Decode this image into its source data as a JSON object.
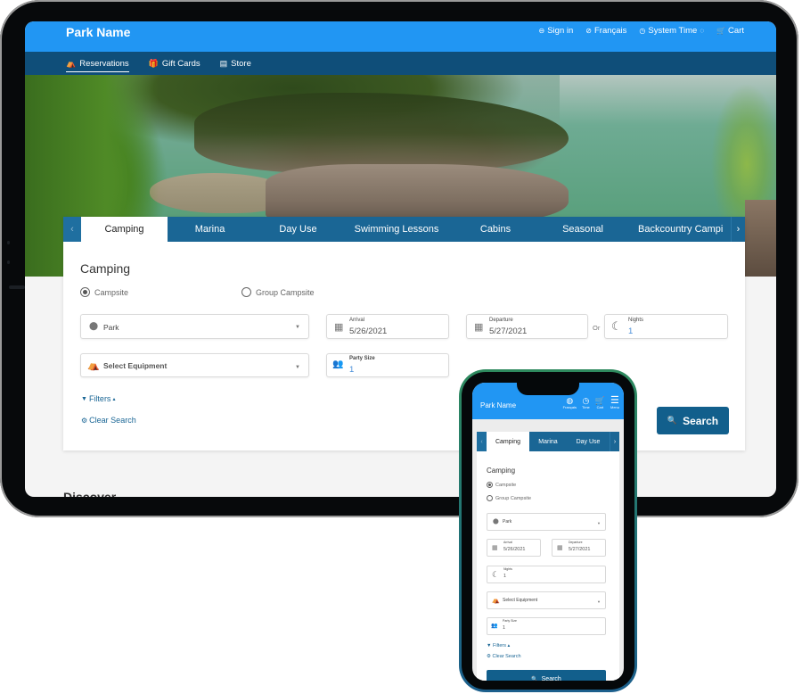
{
  "tablet": {
    "header": {
      "brand": "Park Name",
      "utility_links": [
        {
          "icon": "user-icon",
          "glyph": "⊖",
          "label": "Sign in"
        },
        {
          "icon": "globe-icon",
          "glyph": "⊘",
          "label": "Français"
        },
        {
          "icon": "clock-icon",
          "glyph": "◷",
          "label": "System Time"
        },
        {
          "icon": "cart-icon",
          "glyph": "🛒",
          "label": "Cart"
        }
      ],
      "system_time_suffix_glyph": "◌"
    },
    "subnav": [
      {
        "icon": "tent-icon",
        "glyph": "⛺",
        "label": "Reservations",
        "active": true
      },
      {
        "icon": "gift-icon",
        "glyph": "🎁",
        "label": "Gift Cards",
        "active": false
      },
      {
        "icon": "store-icon",
        "glyph": "▤",
        "label": "Store",
        "active": false
      }
    ],
    "tabs": {
      "prev_glyph": "‹",
      "next_glyph": "›",
      "items": [
        "Camping",
        "Marina",
        "Day Use",
        "Swimming Lessons",
        "Cabins",
        "Seasonal",
        "Backcountry Campi"
      ],
      "active": "Camping"
    },
    "form": {
      "title": "Camping",
      "radios": [
        {
          "label": "Campsite",
          "checked": true
        },
        {
          "label": "Group Campsite",
          "checked": false
        }
      ],
      "park": {
        "icon_glyph": "⬤",
        "value": "Park",
        "caret": "▼"
      },
      "arrival": {
        "label": "Arrival",
        "value": "5/26/2021",
        "icon_glyph": "▦"
      },
      "or_label": "Or",
      "departure": {
        "label": "Departure",
        "value": "5/27/2021",
        "icon_glyph": "▦"
      },
      "nights": {
        "label": "Nights",
        "value": "1",
        "icon_glyph": "☾"
      },
      "equipment": {
        "icon_glyph": "⛺",
        "placeholder": "Select Equipment",
        "caret": "▼"
      },
      "party_size": {
        "label": "Party Size",
        "value": "1",
        "icon_glyph": "👥"
      },
      "filters": {
        "label": "Filters",
        "icon_glyph": "▼",
        "toggle_glyph": "▴"
      },
      "clear_search": {
        "label": "Clear Search",
        "icon_glyph": "⚙"
      },
      "search_button": {
        "label": "Search",
        "icon_glyph": "🔍"
      }
    },
    "discover_heading": "Discover"
  },
  "phone": {
    "header": {
      "brand": "Park Name",
      "icons": [
        {
          "icon": "globe-icon",
          "glyph": "◍",
          "label": "Français"
        },
        {
          "icon": "clock-icon",
          "glyph": "◷",
          "label": "Time"
        },
        {
          "icon": "cart-icon",
          "glyph": "🛒",
          "label": "Cart"
        },
        {
          "icon": "menu-icon",
          "glyph": "☰",
          "label": "Menu"
        }
      ]
    },
    "tabs": {
      "prev_glyph": "‹",
      "next_glyph": "›",
      "items": [
        "Camping",
        "Marina",
        "Day Use"
      ],
      "active": "Camping"
    },
    "form": {
      "title": "Camping",
      "radios": [
        {
          "label": "Campsite",
          "checked": true
        },
        {
          "label": "Group Campsite",
          "checked": false
        }
      ],
      "park": {
        "value": "Park",
        "icon_glyph": "⬤",
        "caret": "▼"
      },
      "arrival": {
        "label": "Arrival",
        "value": "5/26/2021",
        "icon_glyph": "▦"
      },
      "departure": {
        "label": "Departure",
        "value": "5/27/2021",
        "icon_glyph": "▦"
      },
      "nights": {
        "label": "Nights",
        "value": "1",
        "icon_glyph": "☾"
      },
      "equipment": {
        "placeholder": "Select Equipment",
        "icon_glyph": "⛺",
        "caret": "▼"
      },
      "party_size": {
        "label": "Party Size",
        "value": "1",
        "icon_glyph": "👥"
      },
      "filters": {
        "label": "Filters",
        "icon_glyph": "▼",
        "toggle_glyph": "▴"
      },
      "clear_search": {
        "label": "Clear Search",
        "icon_glyph": "⚙"
      },
      "search_button": {
        "label": "Search",
        "icon_glyph": "🔍"
      }
    }
  },
  "colors": {
    "header_blue": "#2196f3",
    "subnav_navy": "#0f4e79",
    "tab_blue": "#1a6695",
    "button_blue": "#125f8c",
    "link_blue": "#1a6695"
  }
}
